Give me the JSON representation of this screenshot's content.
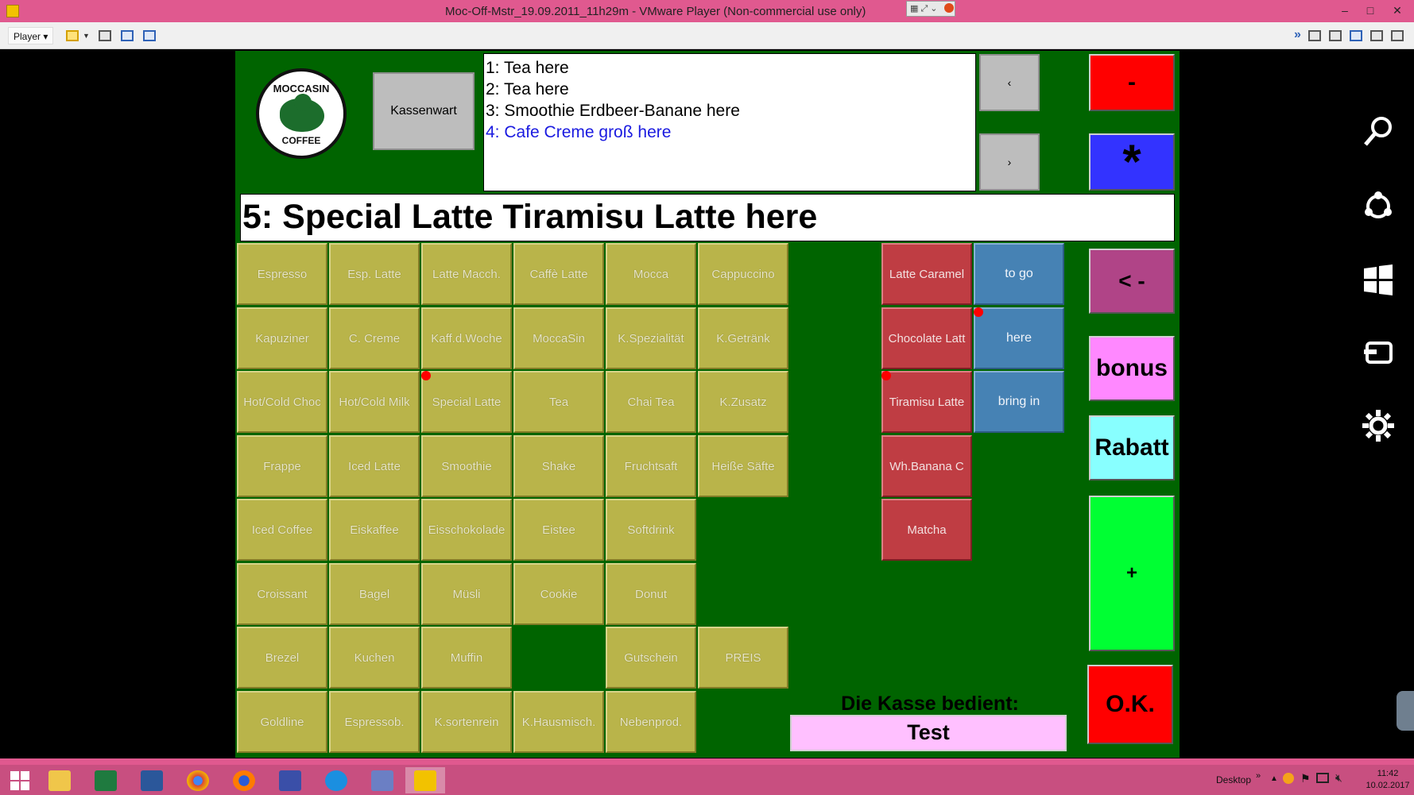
{
  "window": {
    "title": "Moc-Off-Mstr_19.09.2011_11h29m - VMware Player (Non-commercial use only)",
    "minimize": "–",
    "maximize": "□",
    "close": "✕"
  },
  "toolbar": {
    "player_menu": "Player ▾"
  },
  "pos": {
    "logo_top": "MOCCASIN",
    "logo_bottom": "COFFEE",
    "kassenwart": "Kassenwart",
    "orders": [
      {
        "text": "1: Tea here"
      },
      {
        "text": "2: Tea here"
      },
      {
        "text": "3: Smoothie Erdbeer-Banane here"
      },
      {
        "text": "4: Cafe Creme groß  here"
      }
    ],
    "prev_label": "‹",
    "next_label": "›",
    "current_item": "5: Special Latte Tiramisu Latte here",
    "products": [
      [
        "Espresso",
        "Esp. Latte",
        "Latte Macch.",
        "Caffè Latte",
        "Mocca",
        "Cappuccino"
      ],
      [
        "Kapuziner",
        "C. Creme",
        "Kaff.d.Woche",
        "MoccaSin",
        "K.Spezialität",
        "K.Getränk"
      ],
      [
        "Hot/Cold Choc",
        "Hot/Cold Milk",
        "Special Latte",
        "Tea",
        "Chai Tea",
        "K.Zusatz"
      ],
      [
        "Frappe",
        "Iced Latte",
        "Smoothie",
        "Shake",
        "Fruchtsaft",
        "Heiße Säfte"
      ],
      [
        "Iced Coffee",
        "Eiskaffee",
        "Eisschokolade",
        "Eistee",
        "Softdrink",
        ""
      ],
      [
        "Croissant",
        "Bagel",
        "Müsli",
        "Cookie",
        "Donut",
        ""
      ],
      [
        "Brezel",
        "Kuchen",
        "Muffin",
        "",
        "Gutschein",
        "PREIS"
      ],
      [
        "Goldline",
        "Espressob.",
        "K.sortenrein",
        "K.Hausmisch.",
        "Nebenprod.",
        ""
      ]
    ],
    "modifiers": [
      "Latte Caramel",
      "Chocolate Latt",
      "Tiramisu Latte",
      "Wh.Banana C",
      "Matcha"
    ],
    "modes": [
      "to go",
      "here",
      "bring in"
    ],
    "actions": {
      "minus": "-",
      "star": "*",
      "backspace": "< -",
      "bonus": "bonus",
      "rabatt": "Rabatt",
      "plus": "+",
      "ok": "O.K."
    },
    "cashier_label": "Die Kasse bedient:",
    "cashier_name": "Test"
  },
  "colors": {
    "pos_background": "#006400",
    "product": "#b9b44a",
    "modifier": "#bf3d43",
    "mode": "#4682b4",
    "minus": "#ff0000",
    "star": "#3333ff",
    "backspace": "#b04487",
    "bonus": "#ff88ff",
    "rabatt": "#88ffff",
    "plus": "#00ff33",
    "ok": "#ff0000"
  },
  "charms": [
    "search-icon",
    "share-icon",
    "windows-start-icon",
    "devices-icon",
    "settings-icon"
  ],
  "taskbar": {
    "apps": [
      "start-icon",
      "file-explorer-icon",
      "excel-icon",
      "word-icon",
      "chrome-icon",
      "firefox-icon",
      "save-app-icon",
      "internet-explorer-icon",
      "remote-desktop-icon",
      "vmware-icon"
    ],
    "desktop_label": "Desktop",
    "time": "11:42",
    "date": "10.02.2017"
  }
}
